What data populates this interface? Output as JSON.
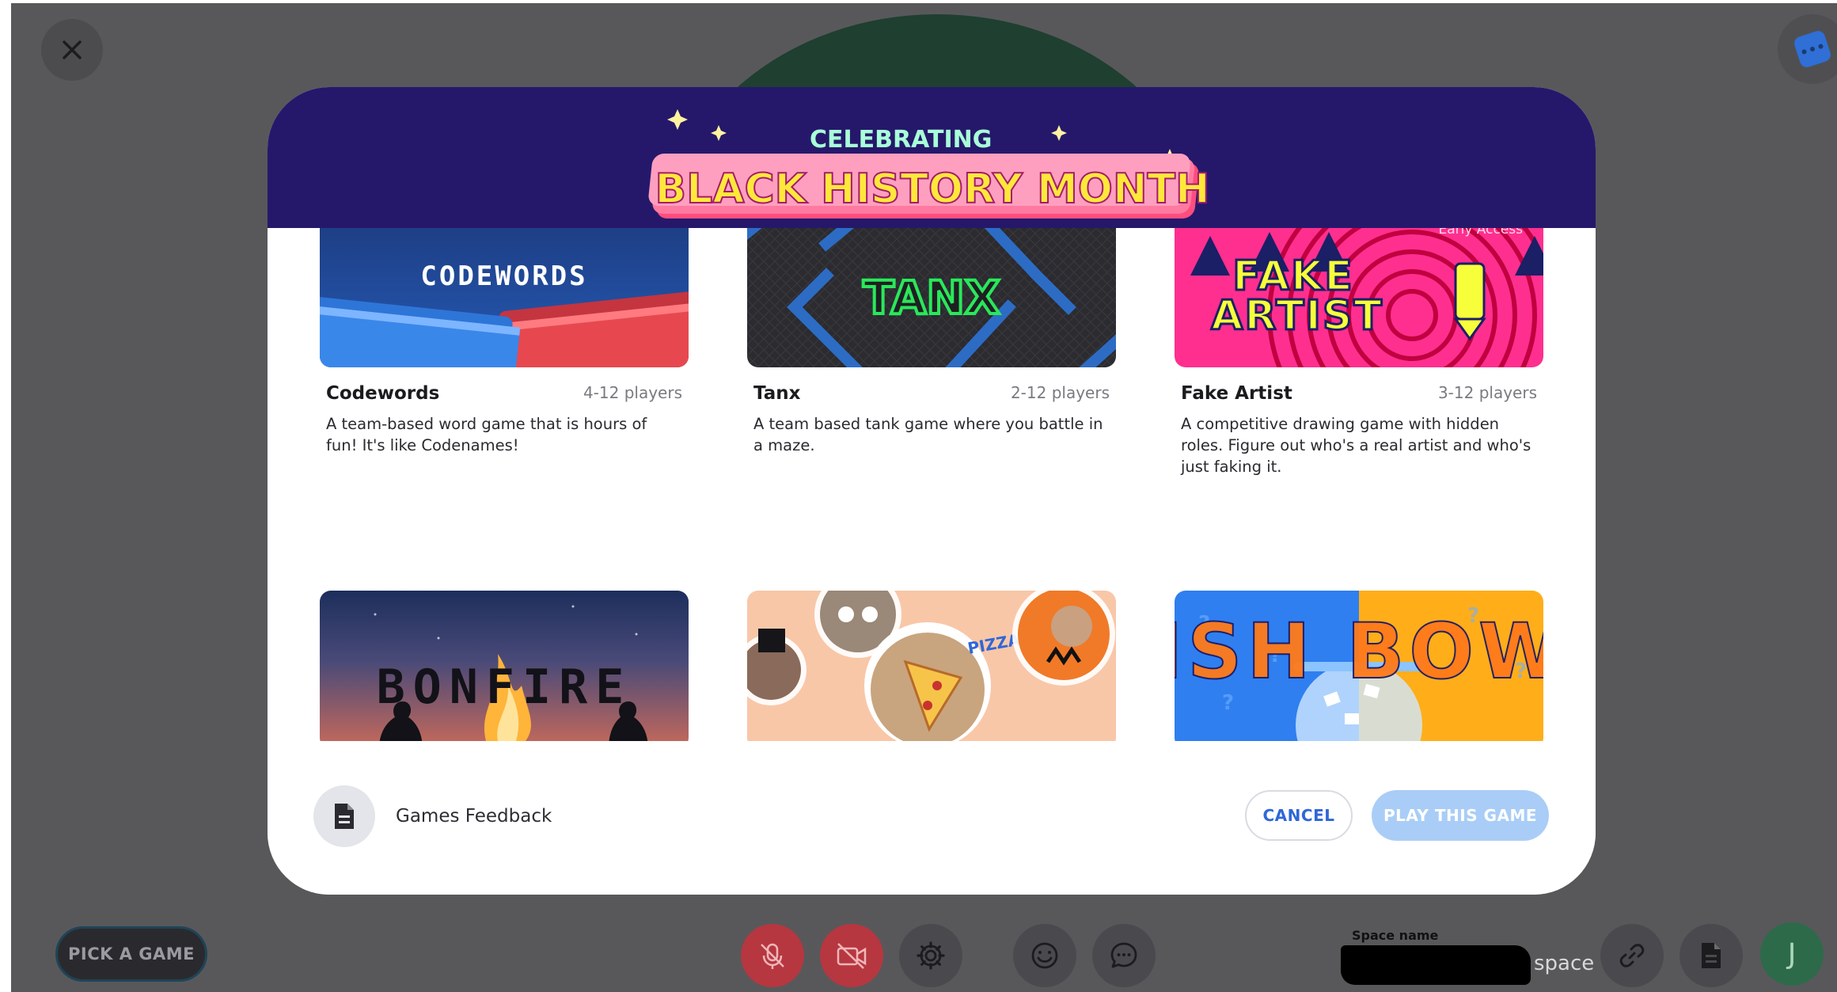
{
  "banner": {
    "line1": "CELEBRATING",
    "line2": "BLACK HISTORY MONTH"
  },
  "games": [
    {
      "name": "Codewords",
      "players": "4-12 players",
      "description": "A team-based word game that is hours of fun! It's like Codenames!",
      "thumb_title": "CODEWORDS"
    },
    {
      "name": "Tanx",
      "players": "2-12 players",
      "description": "A team based tank game where you battle in a maze.",
      "thumb_title": "TANX"
    },
    {
      "name": "Fake Artist",
      "players": "3-12 players",
      "description": "A competitive drawing game with hidden roles. Figure out who's a real artist and who's just faking it.",
      "thumb_title": "FAKE ARTIST",
      "badge": "Early Access"
    },
    {
      "thumb_title": "BONFIRE"
    },
    {
      "thumb_title": "PIZZA LOL"
    },
    {
      "thumb_title": "FISH BOWL"
    }
  ],
  "footer": {
    "feedback_label": "Games Feedback",
    "cancel_label": "CANCEL",
    "play_label": "PLAY THIS GAME"
  },
  "toolbar": {
    "pick_label": "PICK A GAME",
    "space_title": "Space name",
    "space_suffix": "space",
    "avatar_initial": "J"
  },
  "icons": {
    "close": "close-icon",
    "dice": "dice-icon",
    "document": "document-icon",
    "mic_off": "mic-off-icon",
    "camera_off": "camera-off-icon",
    "settings": "gear-icon",
    "emoji": "emoji-icon",
    "chat": "chat-icon",
    "link": "link-icon"
  },
  "colors": {
    "banner_bg": "#25186b",
    "accent_blue": "#2f67d8",
    "play_disabled": "#a9cdf6",
    "toolbar_red": "#b6373f"
  }
}
